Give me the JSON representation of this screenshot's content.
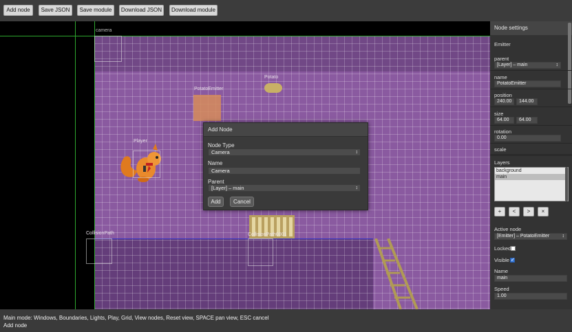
{
  "toolbar": {
    "add_node": "Add node",
    "save_json": "Save JSON",
    "save_module": "Save module",
    "download_json": "Download JSON",
    "download_module": "Download module"
  },
  "canvas": {
    "camera_label": "camera",
    "nodes": {
      "potato": "Potato",
      "potato_emitter": "PotatoEmitter",
      "player": "Player",
      "collision_path": "CollisionPath",
      "collision_path_1": "CollisionPath0001"
    }
  },
  "modal": {
    "title": "Add Node",
    "node_type_label": "Node Type",
    "node_type_value": "Camera",
    "name_label": "Name",
    "name_value": "Camera",
    "parent_label": "Parent",
    "parent_value": "[Layer] – main",
    "add_button": "Add",
    "cancel_button": "Cancel"
  },
  "sidebar": {
    "title": "Node settings",
    "node_kind": "Emitter",
    "parent_label": "parent",
    "parent_value": "[Layer] – main",
    "name_label": "name",
    "name_value": "PotatoEmitter",
    "position_label": "position",
    "position_x": "240.00",
    "position_y": "144.00",
    "size_label": "size",
    "size_w": "64.00",
    "size_h": "64.00",
    "rotation_label": "rotation",
    "rotation_value": "0.00",
    "scale_label": "scale",
    "layers_title": "Layers",
    "layers": [
      "background",
      "main"
    ],
    "layer_buttons": [
      "+",
      "<",
      ">",
      "×"
    ],
    "active_node_label": "Active node",
    "active_node_value": "[Emitter] – PotatoEmitter",
    "locked_label": "Locked",
    "locked": false,
    "visible_label": "Visible",
    "visible": true,
    "layer_name_label": "Name",
    "layer_name_value": "main",
    "speed_label": "Speed",
    "speed_value": "1.00"
  },
  "status": {
    "line1": "Main mode: Windows, Boundaries, Lights, Play, Grid, View nodes, Reset view, SPACE pan view, ESC cancel",
    "line2": "Add node"
  }
}
